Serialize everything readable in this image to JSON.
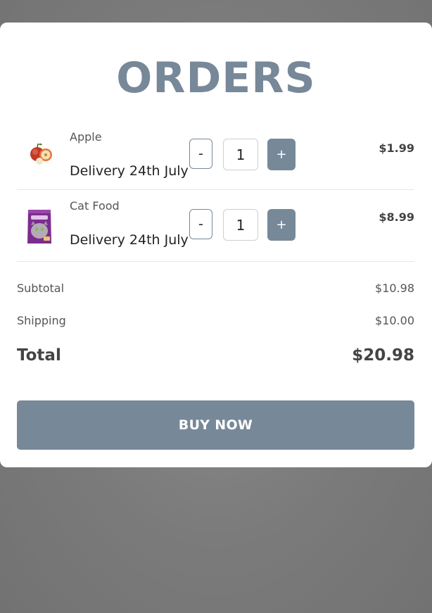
{
  "page": {
    "title": "ORDERS"
  },
  "items": [
    {
      "name": "Apple",
      "delivery": "Delivery 24th July",
      "quantity": "1",
      "price": "$1.99",
      "image_icon": "apple-image",
      "minus_label": "-",
      "plus_label": "+"
    },
    {
      "name": "Cat Food",
      "delivery": "Delivery 24th July",
      "quantity": "1",
      "price": "$8.99",
      "image_icon": "cat-food-pouch-image",
      "minus_label": "-",
      "plus_label": "+"
    }
  ],
  "summary": {
    "subtotal_label": "Subtotal",
    "subtotal_value": "$10.98",
    "shipping_label": "Shipping",
    "shipping_value": "$10.00",
    "total_label": "Total",
    "total_value": "$20.98"
  },
  "actions": {
    "buy_label": "BUY NOW"
  },
  "colors": {
    "accent": "#778899",
    "background_overlay": "#808080",
    "card": "#ffffff"
  }
}
